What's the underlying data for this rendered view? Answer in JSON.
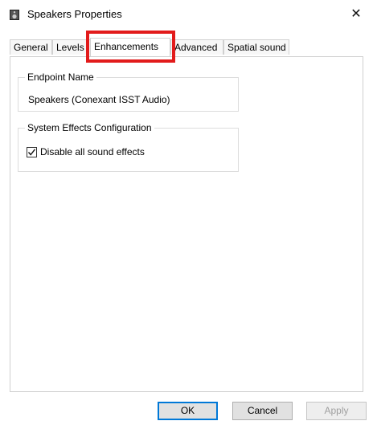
{
  "window": {
    "title": "Speakers Properties",
    "close_label": "✕"
  },
  "tabs": [
    {
      "label": "General"
    },
    {
      "label": "Levels"
    },
    {
      "label": "Enhancements"
    },
    {
      "label": "Advanced"
    },
    {
      "label": "Spatial sound"
    }
  ],
  "active_tab": "Enhancements",
  "endpoint": {
    "group_label": "Endpoint Name",
    "value": "Speakers (Conexant ISST Audio)"
  },
  "system_effects": {
    "group_label": "System Effects Configuration",
    "checkbox_label": "Disable all sound effects",
    "checked": true
  },
  "buttons": {
    "ok": "OK",
    "cancel": "Cancel",
    "apply": "Apply"
  },
  "colors": {
    "highlight": "#e21b1b",
    "default_button_border": "#0078d7"
  }
}
